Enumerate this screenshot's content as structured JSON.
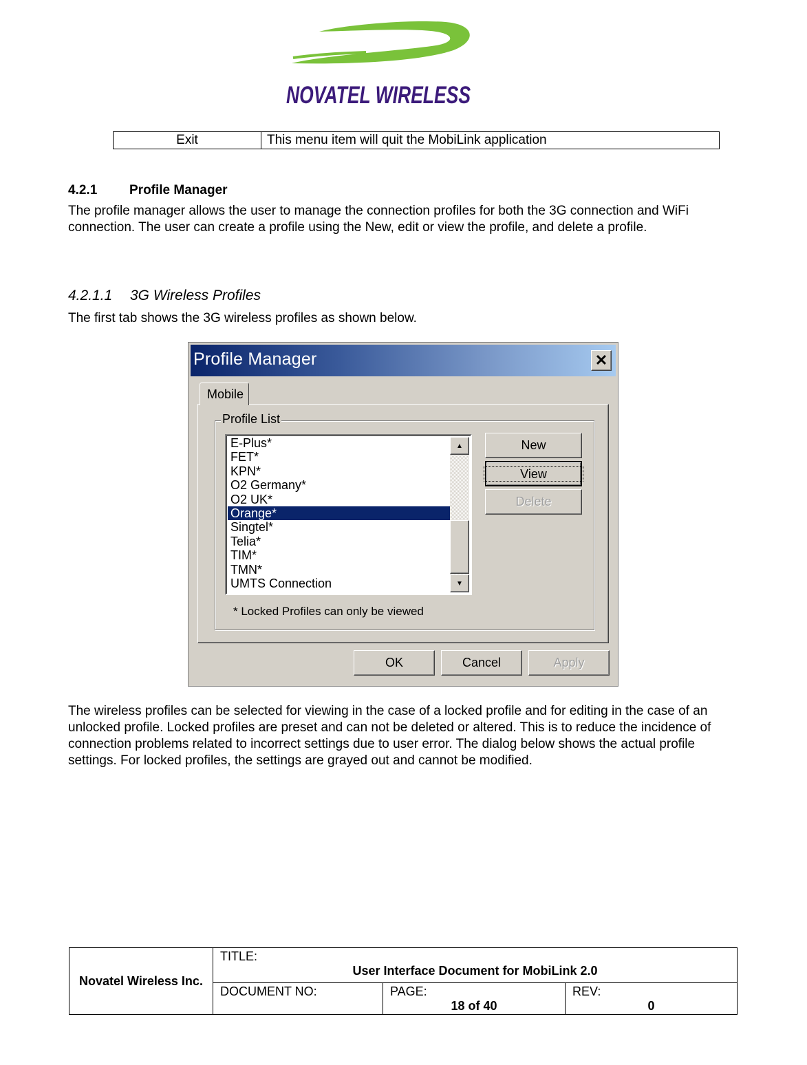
{
  "header": {
    "logo_text": "NOVATEL WIRELESS",
    "logo_colors": {
      "swoosh": "#7ac23a",
      "text": "#3b1a7a"
    }
  },
  "menu_table": {
    "rows": [
      {
        "item": "Exit",
        "description": "This menu item will quit the MobiLink application"
      }
    ]
  },
  "section": {
    "number": "4.2.1",
    "title": "Profile Manager",
    "paragraph": "The profile manager allows the user to manage the connection profiles for both the 3G connection and WiFi connection.  The user can create a profile using the New, edit or view the profile, and delete a profile."
  },
  "subsection": {
    "number": "4.2.1.1",
    "title": "3G Wireless Profiles",
    "paragraph": "The first tab shows the 3G wireless profiles as shown below."
  },
  "dialog": {
    "title": "Profile Manager",
    "close_icon": "close-x",
    "tabs": [
      {
        "label": "Mobile",
        "active": true
      }
    ],
    "group_label": "Profile List",
    "profiles": [
      {
        "name": "E-Plus*",
        "selected": false
      },
      {
        "name": "FET*",
        "selected": false
      },
      {
        "name": "KPN*",
        "selected": false
      },
      {
        "name": "O2 Germany*",
        "selected": false
      },
      {
        "name": "O2 UK*",
        "selected": false
      },
      {
        "name": "Orange*",
        "selected": true
      },
      {
        "name": "Singtel*",
        "selected": false
      },
      {
        "name": "Telia*",
        "selected": false
      },
      {
        "name": "TIM*",
        "selected": false
      },
      {
        "name": "TMN*",
        "selected": false
      },
      {
        "name": "UMTS Connection",
        "selected": false
      }
    ],
    "buttons": {
      "new": "New",
      "view": "View",
      "delete": "Delete",
      "ok": "OK",
      "cancel": "Cancel",
      "apply": "Apply"
    },
    "note": "* Locked Profiles can only be viewed",
    "selection_color": "#0a246a"
  },
  "body_paragraph": "The wireless profiles can be selected for viewing in the case of a locked profile and for editing in the case of an unlocked profile.  Locked profiles are preset and can not be deleted or altered.  This is to reduce the incidence of connection problems related to incorrect settings due to user error.  The dialog below shows the actual profile settings.  For locked profiles, the settings are grayed out and cannot be modified.",
  "footer": {
    "company": "Novatel Wireless Inc.",
    "title_label": "TITLE:",
    "title_value": "User Interface Document for MobiLink 2.0",
    "docno_label": "DOCUMENT NO:",
    "docno_value": "",
    "page_label": "PAGE:",
    "page_value": "18 of 40",
    "rev_label": "REV:",
    "rev_value": "0"
  }
}
